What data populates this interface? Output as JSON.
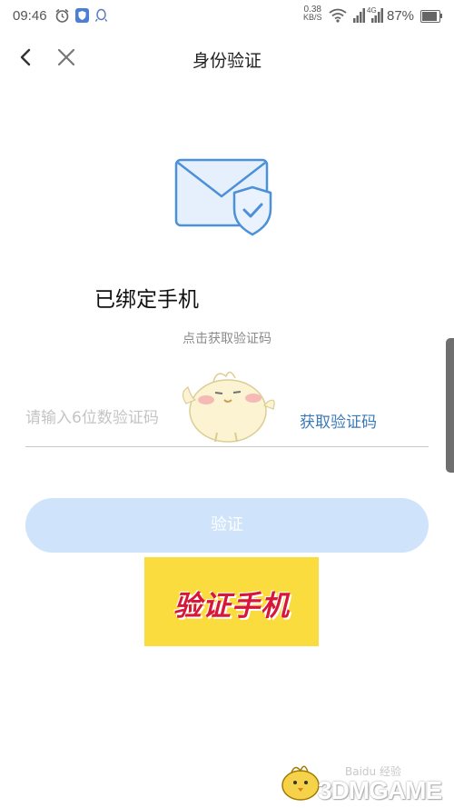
{
  "status_bar": {
    "time": "09:46",
    "net_speed_value": "0.38",
    "net_speed_unit": "KB/S",
    "network_label": "4G",
    "battery_percent": "87%",
    "battery_level": 0.87
  },
  "nav": {
    "title": "身份验证"
  },
  "main": {
    "bound_label": "已绑定手机",
    "hint": "点击获取验证码",
    "code_placeholder": "请输入6位数验证码",
    "code_value": "",
    "get_code_label": "获取验证码",
    "verify_label": "验证"
  },
  "banner": {
    "text": "验证手机"
  },
  "watermark": {
    "brand": "3DMGAME",
    "baidu": "Baidu 经验"
  },
  "colors": {
    "accent": "#3a7ab8",
    "button_disabled": "#cfe3fb",
    "banner_bg": "#fbdc3f",
    "banner_text": "#d8163a"
  }
}
